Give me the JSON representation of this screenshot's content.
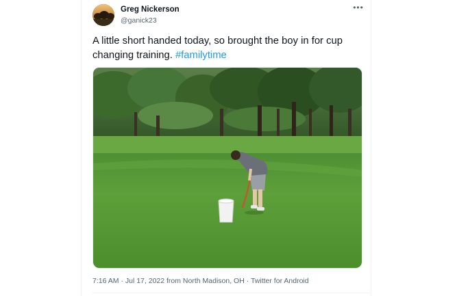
{
  "author": {
    "name": "Greg Nickerson",
    "handle": "@ganick23"
  },
  "menu": {
    "more_label": "•••"
  },
  "tweet": {
    "text": "A little short handed today, so brought the boy in for cup changing training.",
    "hashtag": "#familytime"
  },
  "meta": {
    "time": "7:16 AM",
    "separator": "·",
    "date": "Jul 17, 2022",
    "location": "from North Madison, OH",
    "source": "Twitter for Android"
  },
  "colors": {
    "link": "#1d9bf0",
    "text": "#0f1419",
    "secondary": "#536471"
  },
  "icons": {
    "avatar": "profile-photo",
    "more": "more-options-icon"
  }
}
